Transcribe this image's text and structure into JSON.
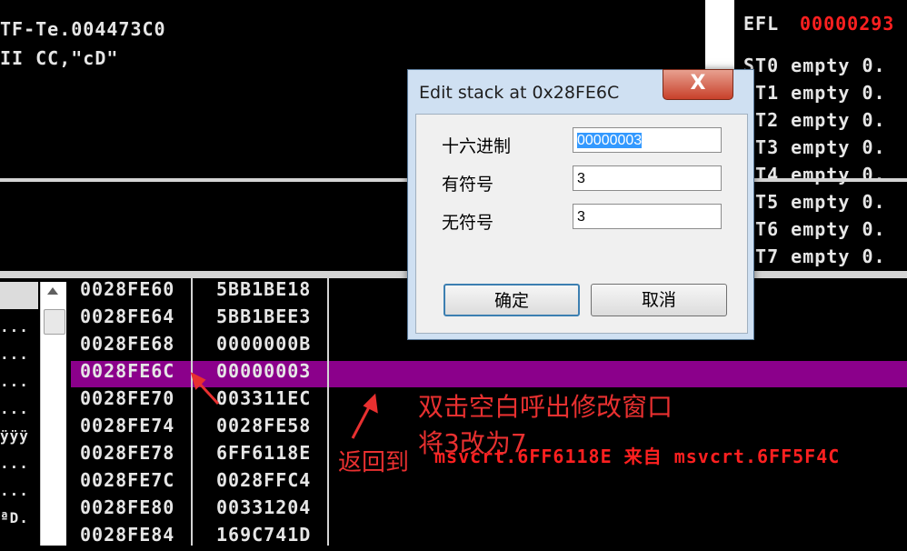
{
  "disasm": {
    "lines": [
      "TF-Te.004473C0",
      "II CC,\"cD\""
    ]
  },
  "registers": {
    "efl": {
      "label": "EFL",
      "value": "00000293"
    },
    "fpu": [
      {
        "name": "ST0",
        "state": "empty",
        "val": "0."
      },
      {
        "name": "ST1",
        "state": "empty",
        "val": "0."
      },
      {
        "name": "ST2",
        "state": "empty",
        "val": "0."
      },
      {
        "name": "ST3",
        "state": "empty",
        "val": "0."
      },
      {
        "name": "ST4",
        "state": "empty",
        "val": "0."
      },
      {
        "name": "ST5",
        "state": "empty",
        "val": "0."
      },
      {
        "name": "ST6",
        "state": "empty",
        "val": "0."
      },
      {
        "name": "ST7",
        "state": "empty",
        "val": "0."
      }
    ]
  },
  "leftpane": {
    "rows": [
      "",
      "...",
      "...",
      "...",
      "...",
      "ÿÿÿ",
      "...",
      "...",
      "ªD.",
      "ªD."
    ]
  },
  "stack": {
    "rows": [
      {
        "addr": "0028FE60",
        "val": "5BB1BE18",
        "cmt": ""
      },
      {
        "addr": "0028FE64",
        "val": "5BB1BEE3",
        "cmt": ""
      },
      {
        "addr": "0028FE68",
        "val": "0000000B",
        "cmt": ""
      },
      {
        "addr": "0028FE6C",
        "val": "00000003",
        "cmt": ""
      },
      {
        "addr": "0028FE70",
        "val": "003311EC",
        "cmt": ""
      },
      {
        "addr": "0028FE74",
        "val": "0028FE58",
        "cmt": ""
      },
      {
        "addr": "0028FE78",
        "val": "6FF6118E",
        "cmt": "msvcrt.6FF6118E 来自 msvcrt.6FF5F4C"
      },
      {
        "addr": "0028FE7C",
        "val": "0028FFC4",
        "cmt": ""
      },
      {
        "addr": "0028FE80",
        "val": "00331204",
        "cmt": ""
      },
      {
        "addr": "0028FE84",
        "val": "169C741D",
        "cmt": ""
      }
    ]
  },
  "dialog": {
    "title": "Edit stack at 0x28FE6C",
    "close": "X",
    "hex_label": "十六进制",
    "hex_value": "00000003",
    "signed_label": "有符号",
    "signed_value": "3",
    "unsigned_label": "无符号",
    "unsigned_value": "3",
    "ok": "确定",
    "cancel": "取消"
  },
  "annotations": {
    "line1": "双击空白呼出修改窗口",
    "line2": "将3改为7",
    "return_label": "返回到"
  },
  "colors": {
    "highlight": "#8b008b",
    "efl_value": "#ff2020",
    "annotation": "#e83030"
  }
}
